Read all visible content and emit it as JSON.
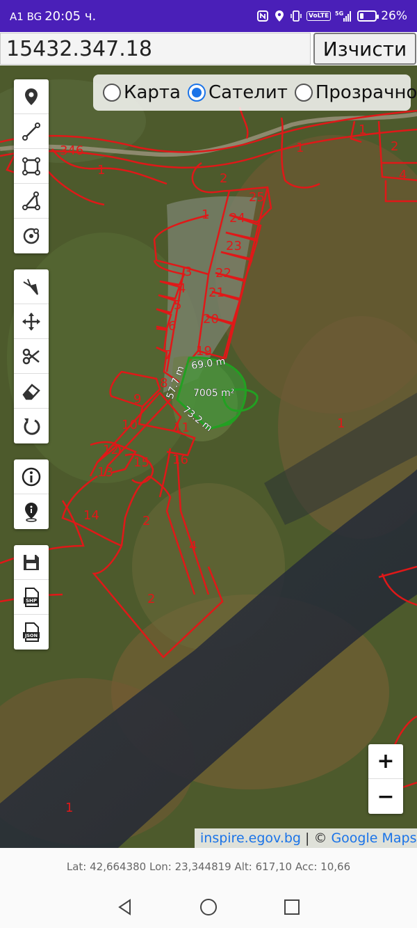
{
  "status_bar": {
    "carrier": "A1 BG",
    "time": "20:05 ч.",
    "battery_percent": "26%",
    "battery_level": 0.26,
    "icons": [
      "nfc-icon",
      "location-icon",
      "vibrate-icon",
      "volte-icon",
      "signal-5g-icon",
      "battery-icon"
    ],
    "volte_label": "VoLTE",
    "network_label": "5G"
  },
  "search": {
    "value": "15432.347.18",
    "clear_label": "Изчисти"
  },
  "layers": {
    "options": [
      {
        "label": "Карта",
        "checked": false
      },
      {
        "label": "Сателит",
        "checked": true
      },
      {
        "label": "Прозрачно",
        "checked": false
      }
    ]
  },
  "toolbar_draw": [
    "add-point-icon",
    "polyline-icon",
    "polygon-icon",
    "triangle-icon",
    "circle-icon"
  ],
  "toolbar_edit": [
    "select-icon",
    "move-icon",
    "cut-icon",
    "eraser-icon",
    "undo-icon"
  ],
  "toolbar_info": [
    "info-icon",
    "location-info-icon"
  ],
  "toolbar_save": {
    "icons": [
      "save-icon",
      "shp-file-icon",
      "json-file-icon"
    ],
    "shp_label": "SHP",
    "json_label": "JSON"
  },
  "map": {
    "measurement": {
      "area": "7005 m²",
      "side_top": "69.0 m",
      "side_left": "57.7 m",
      "side_bottom": "73.2 m"
    },
    "parcel_labels": [
      "346",
      "1",
      "2",
      "25",
      "24",
      "23",
      "22",
      "21",
      "20",
      "19",
      "3",
      "4",
      "5",
      "6",
      "7",
      "8",
      "9",
      "10",
      "11",
      "12",
      "13",
      "14",
      "15",
      "16",
      "1",
      "1",
      "2",
      "3",
      "4",
      "2",
      "1",
      "1",
      "2",
      "4",
      "1"
    ],
    "colors": {
      "parcel": "#e01818",
      "measure": "#22a022"
    }
  },
  "zoom": {
    "plus": "+",
    "minus": "−"
  },
  "attribution": {
    "source": "inspire.egov.bg",
    "separator": "| ©",
    "provider": "Google Maps"
  },
  "coords": {
    "text": "Lat: 42,664380 Lon: 23,344819 Alt: 617,10 Acc: 10,66"
  },
  "nav": [
    "back-icon",
    "home-icon",
    "recents-icon"
  ]
}
